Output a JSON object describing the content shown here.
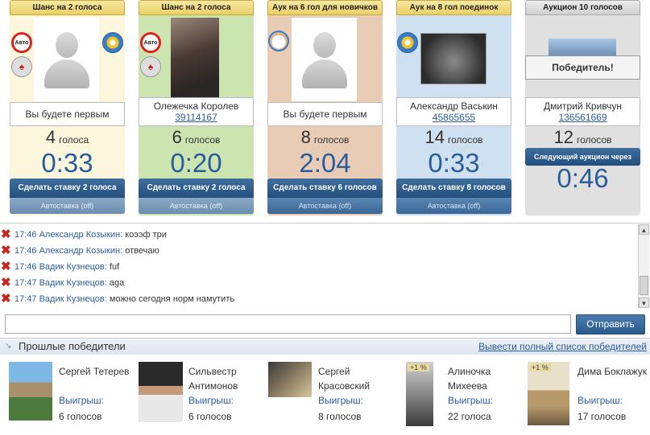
{
  "auctions": [
    {
      "tab": "Шанс на 2 голоса",
      "winner_text": "Вы будете первым",
      "votes": "4",
      "votes_label": "голоса",
      "timer": "0:33",
      "bid_label": "Сделать ставку 2 голоса",
      "auto_label": "Автоставка (off)",
      "bg": "#fbf6dc"
    },
    {
      "tab": "Шанс на 2 голоса",
      "winner_name": "Олежечка Королев",
      "winner_id": "39114167",
      "votes": "6",
      "votes_label": "голосов",
      "timer": "0:20",
      "bid_label": "Сделать ставку 2 голоса",
      "auto_label": "Автоставка (off)",
      "bg": "#cce4b0"
    },
    {
      "tab": "Аук на 6 гол для новичков",
      "winner_text": "Вы будете первым",
      "votes": "8",
      "votes_label": "голосов",
      "timer": "2:04",
      "bid_label": "Сделать ставку 6 голосов",
      "auto_label": "Автоставка (off)",
      "bg": "#e8ccb6"
    },
    {
      "tab": "Аук на 8 гол поединок",
      "winner_name": "Александр Васькин",
      "winner_id": "45865655",
      "votes": "14",
      "votes_label": "голосов",
      "timer": "0:33",
      "bid_label": "Сделать ставку 8 голосов",
      "auto_label": "Автоставка (off)",
      "bg": "#cfe0f0"
    },
    {
      "tab": "Аукцион 10 голосов",
      "winner_banner": "Победитель!",
      "winner_name": "Дмитрий Кривчун",
      "winner_id": "136561669",
      "votes": "12",
      "votes_label": "голосов",
      "next_label": "Следующий аукцион через",
      "timer": "0:46",
      "bg": "#e0e0e0"
    }
  ],
  "chat": {
    "messages": [
      {
        "time": "17:46",
        "author": "Александр Козыкин",
        "text": "коээф три"
      },
      {
        "time": "17:46",
        "author": "Александр Козыкин",
        "text": "отвечаю"
      },
      {
        "time": "17:46",
        "author": "Вадик Кузнецов",
        "text": "fuf"
      },
      {
        "time": "17:47",
        "author": "Вадик Кузнецов",
        "text": "aga"
      },
      {
        "time": "17:47",
        "author": "Вадик Кузнецов",
        "text": "можно сегодня норм намутить"
      }
    ],
    "input_value": "",
    "send_label": "Отправить"
  },
  "past_winners": {
    "title": "Прошлые победители",
    "link_label": "Вывести полный список победителей",
    "win_label": "Выигрыш:",
    "items": [
      {
        "name": "Сергей Тетерев",
        "prize": "6 голосов",
        "badge": ""
      },
      {
        "name": "Сильвестр Антимонов",
        "prize": "6 голосов",
        "badge": ""
      },
      {
        "name": "Сергей Красовский",
        "prize": "8 голосов",
        "badge": ""
      },
      {
        "name": "Алиночка Михеева",
        "prize": "22 голоса",
        "badge": "+1 %"
      },
      {
        "name": "Дима Боклажук",
        "prize": "17 голосов",
        "badge": "+1 %"
      }
    ]
  },
  "icons": {
    "delete": "x-icon",
    "scroll_up": "arrow-up-icon",
    "scroll_down": "arrow-down-icon",
    "section": "arrow-down-right-icon"
  }
}
